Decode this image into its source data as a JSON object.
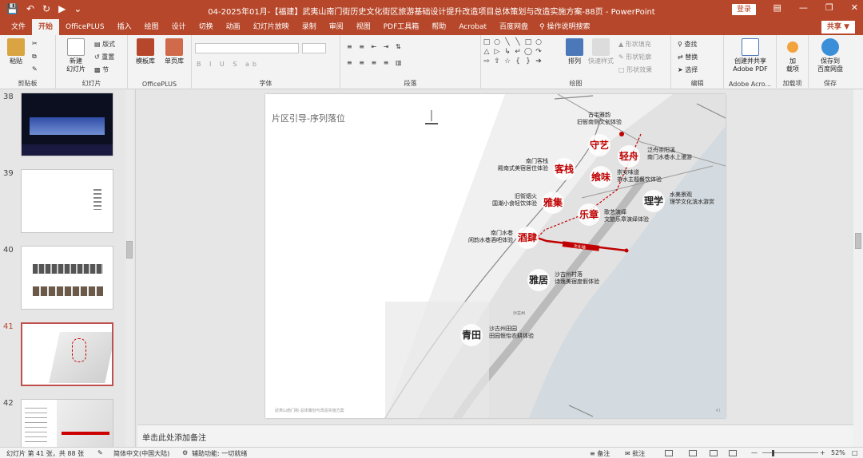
{
  "window": {
    "title": "04-2025年01月-【福建】武夷山南门街历史文化街区旅游基础设计提升改造项目总体策划与改造实施方案-88页 - PowerPoint",
    "login": "登录"
  },
  "tabs": [
    {
      "label": "文件"
    },
    {
      "label": "开始",
      "active": true
    },
    {
      "label": "OfficePLUS"
    },
    {
      "label": "插入"
    },
    {
      "label": "绘图"
    },
    {
      "label": "设计"
    },
    {
      "label": "切换"
    },
    {
      "label": "动画"
    },
    {
      "label": "幻灯片放映"
    },
    {
      "label": "录制"
    },
    {
      "label": "审阅"
    },
    {
      "label": "视图"
    },
    {
      "label": "PDF工具箱"
    },
    {
      "label": "帮助"
    },
    {
      "label": "Acrobat"
    },
    {
      "label": "百度网盘"
    }
  ],
  "tell_me": "操作说明搜索",
  "share": "共享",
  "ribbon": {
    "clipboard": {
      "label": "剪贴板",
      "paste": "粘贴"
    },
    "slides": {
      "label": "幻灯片",
      "new_slide": "新建\n幻灯片",
      "layout": "版式",
      "reset": "重置",
      "section": "节"
    },
    "officeplus": {
      "label": "OfficePLUS",
      "template_lib": "模板库",
      "single_lib": "单页库"
    },
    "font": {
      "label": "字体"
    },
    "paragraph": {
      "label": "段落"
    },
    "drawing": {
      "label": "绘图",
      "arrange": "排列",
      "quick_styles": "快速样式",
      "shape_fill": "形状填充",
      "shape_outline": "形状轮廓",
      "shape_effects": "形状效果"
    },
    "editing": {
      "label": "编辑",
      "find": "查找",
      "replace": "替换",
      "select": "选择"
    },
    "adobe": {
      "label": "Adobe Acro...",
      "create_share": "创建并共享\nAdobe PDF"
    },
    "addins": {
      "label": "加载项",
      "addin": "加\n载项"
    },
    "save": {
      "label": "保存",
      "save_baidu": "保存到\n百度网盘"
    }
  },
  "thumbnails": [
    {
      "num": "38"
    },
    {
      "num": "39"
    },
    {
      "num": "40"
    },
    {
      "num": "41",
      "selected": true
    },
    {
      "num": "42"
    }
  ],
  "slide": {
    "title": "片区引导-序列落位",
    "footer": "武夷山南门街·总体策划与改造实施方案",
    "page": "41",
    "zones": [
      {
        "name": "守艺",
        "desc": [
          "古宅雅韵",
          "旧衙南侧文创体验"
        ]
      },
      {
        "name": "轻舟",
        "desc": [
          "泛舟崇阳溪",
          "南门水巷水上漫游"
        ]
      },
      {
        "name": "客栈",
        "desc": [
          "南门客栈",
          "殿南式美宿居住体验"
        ]
      },
      {
        "name": "飨味",
        "desc": [
          "崇安味道",
          "茶水主题餐饮体验"
        ]
      },
      {
        "name": "理学",
        "desc": [
          "水美景观",
          "理学文化滨水游赏"
        ]
      },
      {
        "name": "雅集",
        "desc": [
          "旧街烟火",
          "国潮小食轻饮体验"
        ]
      },
      {
        "name": "乐章",
        "desc": [
          "歌艺演绎",
          "文旅乐章演绎体验"
        ]
      },
      {
        "name": "酒肆",
        "desc": [
          "南门水巷",
          "闲韵水巷酒吧体验"
        ]
      },
      {
        "name": "雅居",
        "desc": [
          "沙古州村落",
          "诗逸美宿度假体验"
        ]
      },
      {
        "name": "青田",
        "desc": [
          "沙古州田园",
          "田园惬怡农耕体验"
        ]
      }
    ],
    "map_labels": {
      "axis": "文化轴",
      "place": "沙古州"
    }
  },
  "notes_placeholder": "单击此处添加备注",
  "status": {
    "slide_pos": "幻灯片 第 41 张，共 88 张",
    "language": "简体中文(中国大陆)",
    "accessibility": "辅助功能: 一切就绪",
    "notes": "备注",
    "comments": "批注",
    "zoom": "52%"
  },
  "colors": {
    "accent": "#b7472a",
    "zone_red": "#c00000"
  }
}
